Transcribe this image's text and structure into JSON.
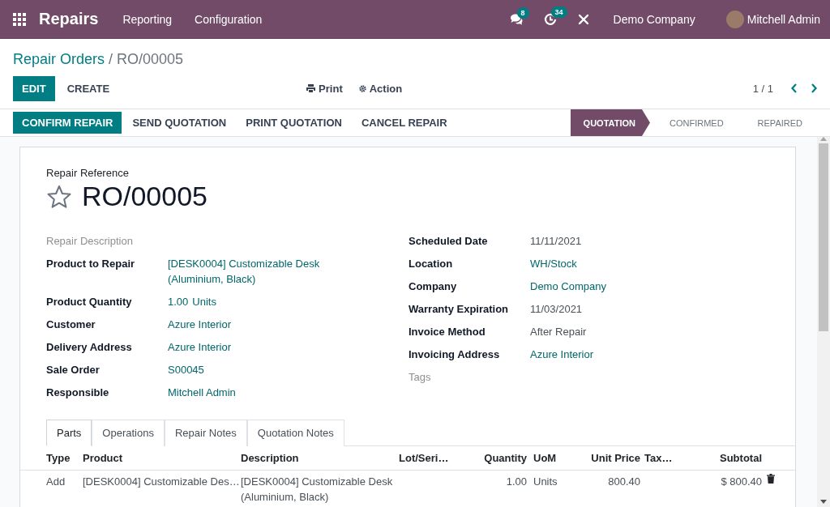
{
  "navbar": {
    "app_name": "Repairs",
    "menu": [
      "Reporting",
      "Configuration"
    ],
    "messages_count": "8",
    "activities_count": "34",
    "company": "Demo Company",
    "user": "Mitchell Admin"
  },
  "breadcrumb": {
    "parent": "Repair Orders",
    "separator": "/",
    "current": "RO/00005"
  },
  "toolbar": {
    "edit": "EDIT",
    "create": "CREATE",
    "print": "Print",
    "action": "Action",
    "pager": "1 / 1"
  },
  "header_buttons": [
    {
      "label": "CONFIRM REPAIR",
      "primary": true
    },
    {
      "label": "SEND QUOTATION",
      "primary": false
    },
    {
      "label": "PRINT QUOTATION",
      "primary": false
    },
    {
      "label": "CANCEL REPAIR",
      "primary": false
    }
  ],
  "stages": [
    {
      "label": "QUOTATION",
      "selected": true
    },
    {
      "label": "CONFIRMED",
      "selected": false
    },
    {
      "label": "REPAIRED",
      "selected": false
    }
  ],
  "form": {
    "reference_label": "Repair Reference",
    "reference": "RO/00005",
    "starred": false,
    "left_fields": [
      {
        "label": "Repair Description",
        "kind": "empty"
      },
      {
        "label": "Product to Repair",
        "kind": "link",
        "value": "[DESK0004] Customizable Desk (Aluminium, Black)"
      },
      {
        "label": "Product Quantity",
        "kind": "quantity",
        "value": "1.00",
        "unit": "Units"
      },
      {
        "label": "Customer",
        "kind": "link",
        "value": "Azure Interior"
      },
      {
        "label": "Delivery Address",
        "kind": "link",
        "value": "Azure Interior"
      },
      {
        "label": "Sale Order",
        "kind": "link",
        "value": "S00045"
      },
      {
        "label": "Responsible",
        "kind": "link",
        "value": "Mitchell Admin"
      }
    ],
    "right_fields": [
      {
        "label": "Scheduled Date",
        "kind": "text",
        "value": "11/11/2021"
      },
      {
        "label": "Location",
        "kind": "link",
        "value": "WH/Stock"
      },
      {
        "label": "Company",
        "kind": "link",
        "value": "Demo Company"
      },
      {
        "label": "Warranty Expiration",
        "kind": "text",
        "value": "11/03/2021"
      },
      {
        "label": "Invoice Method",
        "kind": "text",
        "value": "After Repair"
      },
      {
        "label": "Invoicing Address",
        "kind": "link",
        "value": "Azure Interior"
      },
      {
        "label": "Tags",
        "kind": "empty"
      }
    ],
    "tabs": [
      {
        "label": "Parts",
        "selected": true
      },
      {
        "label": "Operations",
        "selected": false
      },
      {
        "label": "Repair Notes",
        "selected": false
      },
      {
        "label": "Quotation Notes",
        "selected": false
      }
    ],
    "table": {
      "columns": [
        "Type",
        "Product",
        "Description",
        "Lot/Seri…",
        "Quantity",
        "UoM",
        "Unit Price",
        "Tax…",
        "Subtotal"
      ],
      "rows": [
        {
          "cells": [
            "Add",
            "[DESK0004] Customizable Des…",
            "[DESK0004] Customizable Desk (Aluminium, Black)",
            "",
            "1.00",
            "Units",
            "800.40",
            "",
            "$ 800.40"
          ]
        }
      ]
    }
  }
}
